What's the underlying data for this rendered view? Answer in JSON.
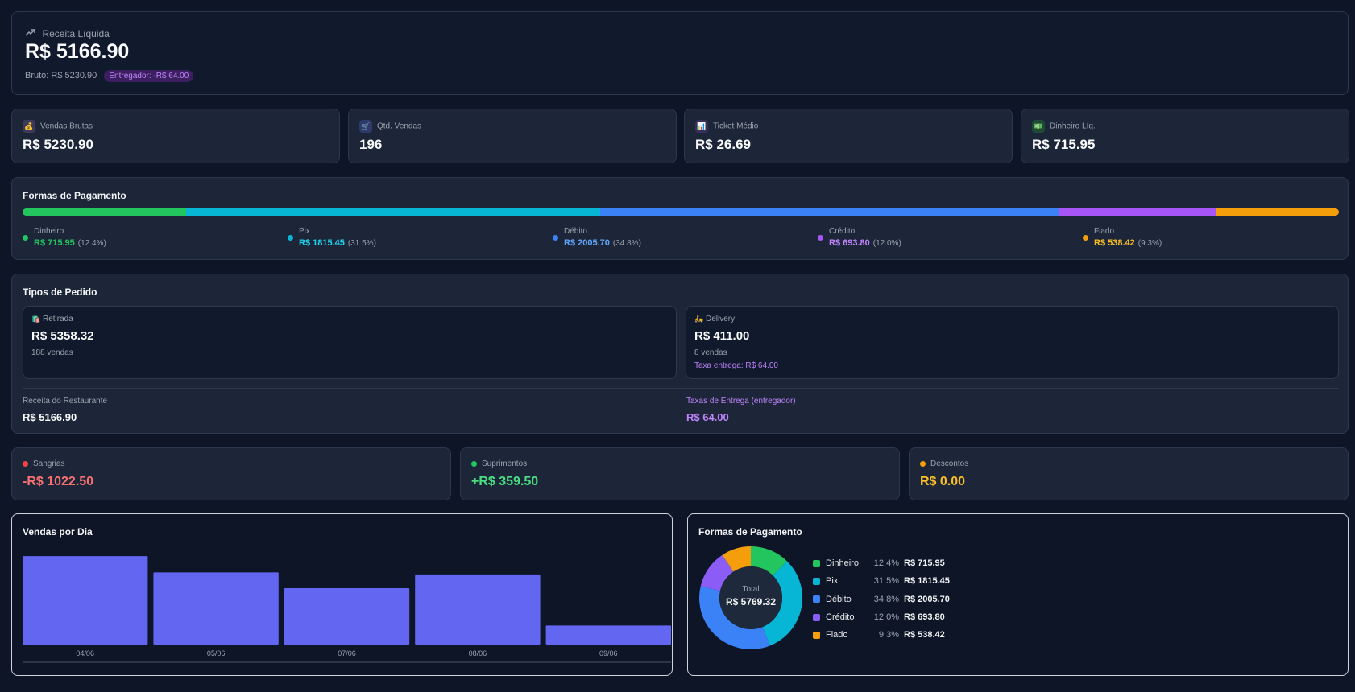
{
  "header": {
    "title": "Receita Líquida",
    "value": "R$ 5166.90",
    "gross": "Bruto: R$ 5230.90",
    "badge": "Entregador: -R$ 64.00"
  },
  "kpis": [
    {
      "label": "Vendas Brutas",
      "value": "R$ 5230.90",
      "icon": "money-bag-icon",
      "glyph": "💰",
      "bg": "#3b3a5a"
    },
    {
      "label": "Qtd. Vendas",
      "value": "196",
      "icon": "cart-icon",
      "glyph": "🛒",
      "bg": "#2e3a6a"
    },
    {
      "label": "Ticket Médio",
      "value": "R$ 26.69",
      "icon": "chart-icon",
      "glyph": "📊",
      "bg": "#3a2e5a"
    },
    {
      "label": "Dinheiro Líq.",
      "value": "R$ 715.95",
      "icon": "cash-icon",
      "glyph": "💵",
      "bg": "#1f4a36"
    }
  ],
  "payment_bar": {
    "title": "Formas de Pagamento",
    "methods": [
      {
        "name": "Dinheiro",
        "value": "R$ 715.95",
        "pct": "(12.4%)",
        "share": 12.4,
        "color": "#22c55e",
        "text_color": "#22c55e"
      },
      {
        "name": "Pix",
        "value": "R$ 1815.45",
        "pct": "(31.5%)",
        "share": 31.5,
        "color": "#06b6d4",
        "text_color": "#22d3ee"
      },
      {
        "name": "Débito",
        "value": "R$ 2005.70",
        "pct": "(34.8%)",
        "share": 34.8,
        "color": "#3b82f6",
        "text_color": "#60a5fa"
      },
      {
        "name": "Crédito",
        "value": "R$ 693.80",
        "pct": "(12.0%)",
        "share": 12.0,
        "color": "#a855f7",
        "text_color": "#c084fc"
      },
      {
        "name": "Fiado",
        "value": "R$ 538.42",
        "pct": "(9.3%)",
        "share": 9.3,
        "color": "#f59e0b",
        "text_color": "#fbbf24"
      }
    ]
  },
  "order_types": {
    "title": "Tipos de Pedido",
    "pickup": {
      "label": "Retirada",
      "value": "R$ 5358.32",
      "count": "188 vendas",
      "icon": "shopping-bags-icon",
      "glyph": "🛍️"
    },
    "delivery": {
      "label": "Delivery",
      "value": "R$ 411.00",
      "count": "8 vendas",
      "fee": "Taxa entrega: R$ 64.00",
      "icon": "scooter-icon",
      "glyph": "🛵"
    },
    "restaurant_label": "Receita do Restaurante",
    "restaurant_value": "R$ 5166.90",
    "fees_label": "Taxas de Entrega (entregador)",
    "fees_value": "R$ 64.00"
  },
  "movements": [
    {
      "label": "Sangrias",
      "value": "-R$ 1022.50",
      "color": "#ef4444",
      "value_color": "#f87171"
    },
    {
      "label": "Suprimentos",
      "value": "+R$ 359.50",
      "color": "#22c55e",
      "value_color": "#4ade80"
    },
    {
      "label": "Descontos",
      "value": "R$ 0.00",
      "color": "#f59e0b",
      "value_color": "#fbbf24"
    }
  ],
  "sales_chart": {
    "title": "Vendas por Dia"
  },
  "pie_panel": {
    "title": "Formas de Pagamento",
    "total_label": "Total",
    "total_value": "R$ 5769.32",
    "legend": [
      {
        "name": "Dinheiro",
        "pct": "12.4%",
        "value": "R$ 715.95"
      },
      {
        "name": "Pix",
        "pct": "31.5%",
        "value": "R$ 1815.45"
      },
      {
        "name": "Débito",
        "pct": "34.8%",
        "value": "R$ 2005.70"
      },
      {
        "name": "Crédito",
        "pct": "12.0%",
        "value": "R$ 693.80"
      },
      {
        "name": "Fiado",
        "pct": "9.3%",
        "value": "R$ 538.42"
      }
    ]
  },
  "chart_data": [
    {
      "type": "bar",
      "title": "Vendas por Dia",
      "categories": [
        "04/06",
        "05/06",
        "07/06",
        "08/06",
        "09/06"
      ],
      "values": [
        1350,
        1100,
        860,
        1070,
        290
      ],
      "ylim": [
        0,
        1400
      ],
      "color": "#6366f1",
      "grid": false
    },
    {
      "type": "pie",
      "title": "Formas de Pagamento",
      "categories": [
        "Dinheiro",
        "Pix",
        "Débito",
        "Crédito",
        "Fiado"
      ],
      "values": [
        715.95,
        1815.45,
        2005.7,
        693.8,
        538.42
      ],
      "colors": [
        "#22c55e",
        "#06b6d4",
        "#3b82f6",
        "#8b5cf6",
        "#f59e0b"
      ]
    }
  ]
}
